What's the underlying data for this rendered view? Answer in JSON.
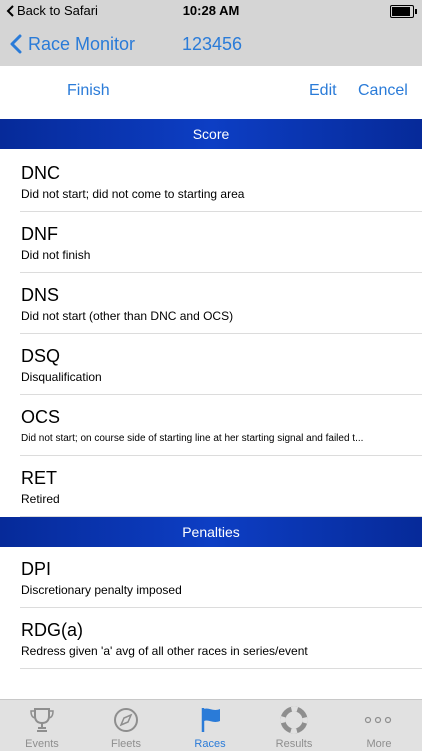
{
  "status_bar": {
    "back_label": "Back to Safari",
    "time": "10:28 AM",
    "battery_level": 0.9
  },
  "nav": {
    "back_label": "Race Monitor",
    "title": "123456"
  },
  "toolbar": {
    "finish_label": "Finish",
    "edit_label": "Edit",
    "cancel_label": "Cancel"
  },
  "sections": [
    {
      "header": "Score",
      "items": [
        {
          "code": "DNC",
          "desc": "Did not start; did not come to starting area"
        },
        {
          "code": "DNF",
          "desc": "Did not finish"
        },
        {
          "code": "DNS",
          "desc": "Did not start (other than DNC and OCS)"
        },
        {
          "code": "DSQ",
          "desc": "Disqualification"
        },
        {
          "code": "OCS",
          "desc": "Did not start; on course side of starting line at her starting signal and failed t..."
        },
        {
          "code": "RET",
          "desc": "Retired"
        }
      ]
    },
    {
      "header": "Penalties",
      "items": [
        {
          "code": "DPI",
          "desc": "Discretionary penalty imposed"
        },
        {
          "code": "RDG(a)",
          "desc": "Redress given 'a' avg of all other races in series/event"
        }
      ]
    }
  ],
  "tabs": [
    {
      "label": "Events",
      "icon": "trophy-icon",
      "active": false
    },
    {
      "label": "Fleets",
      "icon": "compass-icon",
      "active": false
    },
    {
      "label": "Races",
      "icon": "flag-icon",
      "active": true
    },
    {
      "label": "Results",
      "icon": "lifebuoy-icon",
      "active": false
    },
    {
      "label": "More",
      "icon": "more-icon",
      "active": false
    }
  ],
  "colors": {
    "accent": "#2a7bd8",
    "section_header": "#0a36b8",
    "bar_gray": "#d5d5d5"
  }
}
